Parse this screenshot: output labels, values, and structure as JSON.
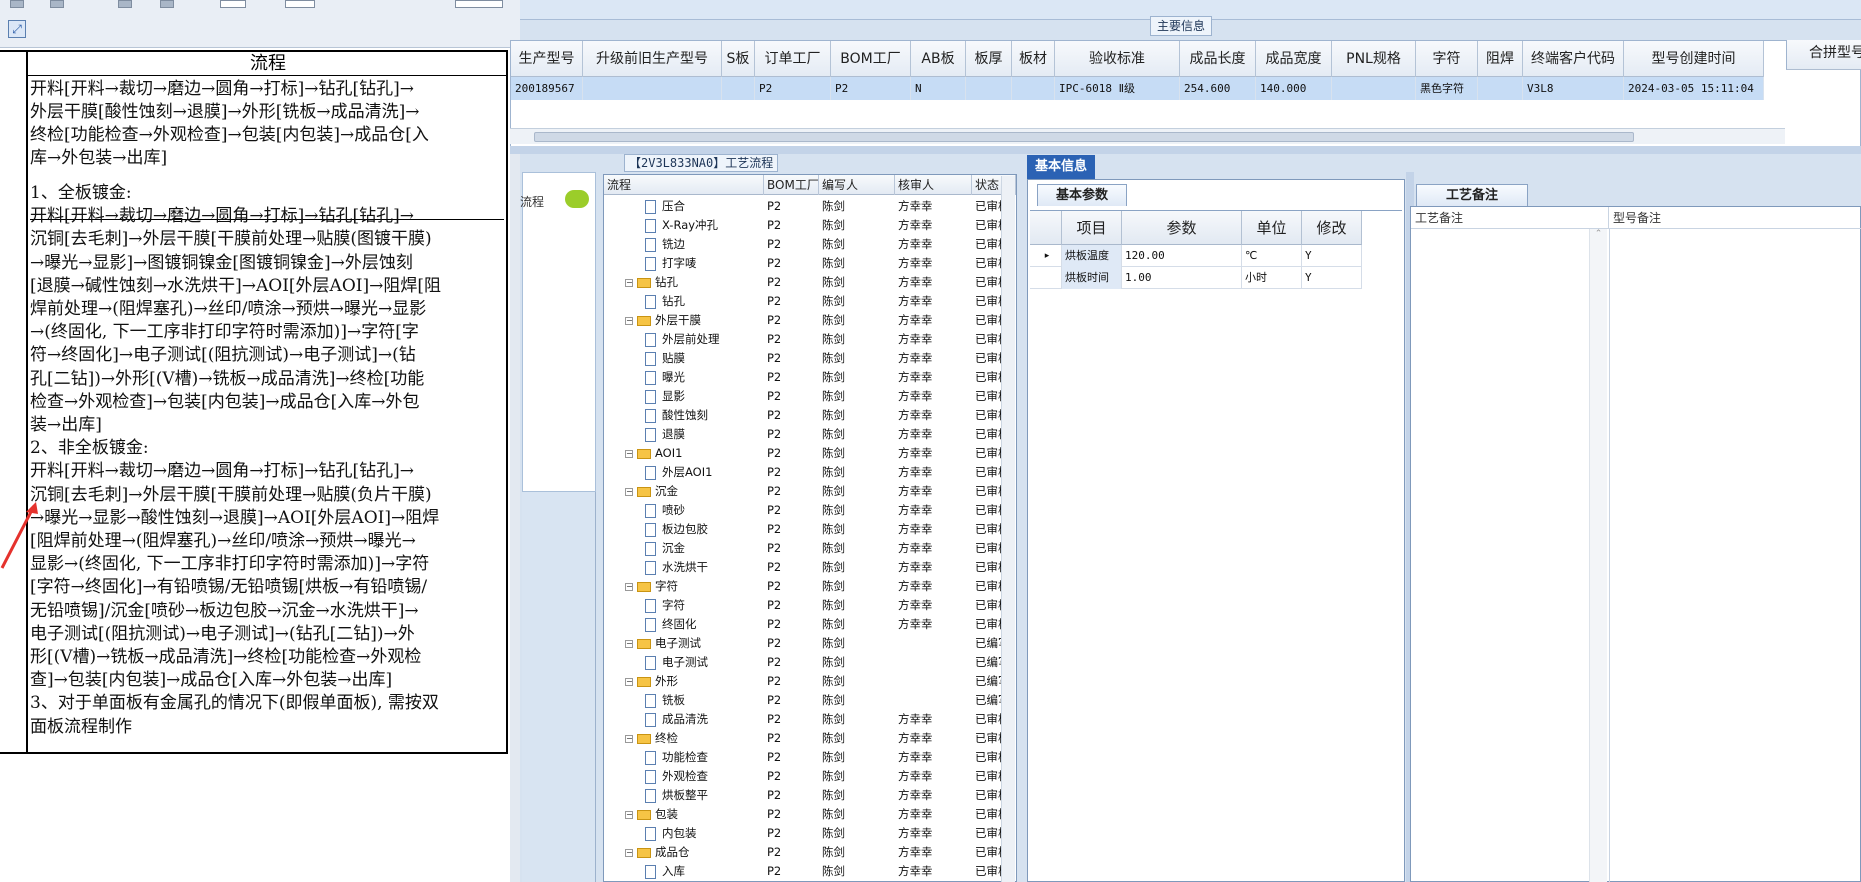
{
  "top_panel": {
    "title": "主要信息",
    "headers": [
      "生产型号",
      "升级前旧生产型号",
      "S板",
      "订单工厂",
      "BOM工厂",
      "AB板",
      "板厚",
      "板材",
      "验收标准",
      "成品长度",
      "成品宽度",
      "PNL规格",
      "字符",
      "阻焊",
      "终端客户代码",
      "型号创建时间"
    ],
    "combine_header": "合拼型号",
    "row": {
      "model": "200189567",
      "order_factory": "P2",
      "bom_factory": "P2",
      "ab_board": "N",
      "acceptance_standard": "IPC-6018 Ⅱ级",
      "length": "254.600",
      "width": "140.000",
      "character": "黑色字符",
      "customer_code": "V3L8",
      "created_time": "2024-03-05 15:11:04"
    }
  },
  "document": {
    "header": "流程",
    "row1": "开料[开料→裁切→磨边→圆角→打标]→钻孔[钻孔]→\n外层干膜[酸性蚀刻→退膜]→外形[铣板→成品清洗]→\n终检[功能检查→外观检查]→包装[内包装]→成品仓[入\n库→外包装→出库]",
    "row2": "1、全板镀金:\n开料[开料→裁切→磨边→圆角→打标]→钻孔[钻孔]→\n沉铜[去毛刺]→外层干膜[干膜前处理→贴膜(图镀干膜)\n→曝光→显影]→图镀铜镍金[图镀铜镍金]→外层蚀刻\n[退膜→碱性蚀刻→水洗烘干]→AOI[外层AOI]→阻焊[阻\n焊前处理→(阻焊塞孔)→丝印/喷涂→预烘→曝光→显影\n→(终固化, 下一工序非打印字符时需添加)]→字符[字\n符→终固化]→电子测试[(阻抗测试)→电子测试]→(钻\n孔[二钻])→外形[(V槽)→铣板→成品清洗]→终检[功能\n检查→外观检查]→包装[内包装]→成品仓[入库→外包\n装→出库]\n2、非全板镀金:\n开料[开料→裁切→磨边→圆角→打标]→钻孔[钻孔]→\n沉铜[去毛刺]→外层干膜[干膜前处理→贴膜(负片干膜)\n→曝光→显影→酸性蚀刻→退膜]→AOI[外层AOI]→阻焊\n[阻焊前处理→(阻焊塞孔)→丝印/喷涂→预烘→曝光→\n显影→(终固化, 下一工序非打印字符时需添加)]→字符\n[字符→终固化]→有铅喷锡/无铅喷锡[烘板→有铅喷锡/\n无铅喷锡]/沉金[喷砂→板边包胶→沉金→水洗烘干]→\n电子测试[(阻抗测试)→电子测试]→(钻孔[二钻])→外\n形[(V槽)→铣板→成品清洗]→终检[功能检查→外观检\n查]→包装[内包装]→成品仓[入库→外包装→出库]\n3、对于单面板有金属孔的情况下(即假单面板), 需按双\n面板流程制作"
  },
  "side_strip": {
    "label": "流程"
  },
  "flow_panel": {
    "title": "【2V3L833NA0】工艺流程",
    "headers": [
      "流程",
      "BOM工厂",
      "编写人",
      "核审人",
      "状态"
    ],
    "rows": [
      {
        "level": 2,
        "kind": "doc",
        "name": "压合",
        "bom": "P2",
        "writer": "陈剑",
        "reviewer": "方幸幸",
        "status": "已审核"
      },
      {
        "level": 2,
        "kind": "doc",
        "name": "X-Ray冲孔",
        "bom": "P2",
        "writer": "陈剑",
        "reviewer": "方幸幸",
        "status": "已审核"
      },
      {
        "level": 2,
        "kind": "doc",
        "name": "铣边",
        "bom": "P2",
        "writer": "陈剑",
        "reviewer": "方幸幸",
        "status": "已审核"
      },
      {
        "level": 2,
        "kind": "doc",
        "name": "打字唛",
        "bom": "P2",
        "writer": "陈剑",
        "reviewer": "方幸幸",
        "status": "已审核"
      },
      {
        "level": 1,
        "kind": "folder",
        "name": "钻孔",
        "bom": "P2",
        "writer": "陈剑",
        "reviewer": "方幸幸",
        "status": "已审核"
      },
      {
        "level": 2,
        "kind": "doc",
        "name": "钻孔",
        "bom": "P2",
        "writer": "陈剑",
        "reviewer": "方幸幸",
        "status": "已审核"
      },
      {
        "level": 1,
        "kind": "folder",
        "name": "外层干膜",
        "bom": "P2",
        "writer": "陈剑",
        "reviewer": "方幸幸",
        "status": "已审核"
      },
      {
        "level": 2,
        "kind": "doc",
        "name": "外层前处理",
        "bom": "P2",
        "writer": "陈剑",
        "reviewer": "方幸幸",
        "status": "已审核"
      },
      {
        "level": 2,
        "kind": "doc",
        "name": "贴膜",
        "bom": "P2",
        "writer": "陈剑",
        "reviewer": "方幸幸",
        "status": "已审核"
      },
      {
        "level": 2,
        "kind": "doc",
        "name": "曝光",
        "bom": "P2",
        "writer": "陈剑",
        "reviewer": "方幸幸",
        "status": "已审核"
      },
      {
        "level": 2,
        "kind": "doc",
        "name": "显影",
        "bom": "P2",
        "writer": "陈剑",
        "reviewer": "方幸幸",
        "status": "已审核"
      },
      {
        "level": 2,
        "kind": "doc",
        "name": "酸性蚀刻",
        "bom": "P2",
        "writer": "陈剑",
        "reviewer": "方幸幸",
        "status": "已审核"
      },
      {
        "level": 2,
        "kind": "doc",
        "name": "退膜",
        "bom": "P2",
        "writer": "陈剑",
        "reviewer": "方幸幸",
        "status": "已审核"
      },
      {
        "level": 1,
        "kind": "folder",
        "name": "AOI1",
        "bom": "P2",
        "writer": "陈剑",
        "reviewer": "方幸幸",
        "status": "已审核"
      },
      {
        "level": 2,
        "kind": "doc",
        "name": "外层AOI1",
        "bom": "P2",
        "writer": "陈剑",
        "reviewer": "方幸幸",
        "status": "已审核"
      },
      {
        "level": 1,
        "kind": "folder",
        "name": "沉金",
        "bom": "P2",
        "writer": "陈剑",
        "reviewer": "方幸幸",
        "status": "已审核"
      },
      {
        "level": 2,
        "kind": "doc",
        "name": "喷砂",
        "bom": "P2",
        "writer": "陈剑",
        "reviewer": "方幸幸",
        "status": "已审核"
      },
      {
        "level": 2,
        "kind": "doc",
        "name": "板边包胶",
        "bom": "P2",
        "writer": "陈剑",
        "reviewer": "方幸幸",
        "status": "已审核"
      },
      {
        "level": 2,
        "kind": "doc",
        "name": "沉金",
        "bom": "P2",
        "writer": "陈剑",
        "reviewer": "方幸幸",
        "status": "已审核"
      },
      {
        "level": 2,
        "kind": "doc",
        "name": "水洗烘干",
        "bom": "P2",
        "writer": "陈剑",
        "reviewer": "方幸幸",
        "status": "已审核"
      },
      {
        "level": 1,
        "kind": "folder",
        "name": "字符",
        "bom": "P2",
        "writer": "陈剑",
        "reviewer": "方幸幸",
        "status": "已审核"
      },
      {
        "level": 2,
        "kind": "doc",
        "name": "字符",
        "bom": "P2",
        "writer": "陈剑",
        "reviewer": "方幸幸",
        "status": "已审核"
      },
      {
        "level": 2,
        "kind": "doc",
        "name": "终固化",
        "bom": "P2",
        "writer": "陈剑",
        "reviewer": "方幸幸",
        "status": "已审核"
      },
      {
        "level": 1,
        "kind": "folder",
        "name": "电子测试",
        "bom": "P2",
        "writer": "陈剑",
        "reviewer": "",
        "status": "已编写"
      },
      {
        "level": 2,
        "kind": "doc",
        "name": "电子测试",
        "bom": "P2",
        "writer": "陈剑",
        "reviewer": "",
        "status": "已编写"
      },
      {
        "level": 1,
        "kind": "folder",
        "name": "外形",
        "bom": "P2",
        "writer": "陈剑",
        "reviewer": "",
        "status": "已编写"
      },
      {
        "level": 2,
        "kind": "doc",
        "name": "铣板",
        "bom": "P2",
        "writer": "陈剑",
        "reviewer": "",
        "status": "已编写"
      },
      {
        "level": 2,
        "kind": "doc",
        "name": "成品清洗",
        "bom": "P2",
        "writer": "陈剑",
        "reviewer": "方幸幸",
        "status": "已审核"
      },
      {
        "level": 1,
        "kind": "folder",
        "name": "终检",
        "bom": "P2",
        "writer": "陈剑",
        "reviewer": "方幸幸",
        "status": "已审核"
      },
      {
        "level": 2,
        "kind": "doc",
        "name": "功能检查",
        "bom": "P2",
        "writer": "陈剑",
        "reviewer": "方幸幸",
        "status": "已审核"
      },
      {
        "level": 2,
        "kind": "doc",
        "name": "外观检查",
        "bom": "P2",
        "writer": "陈剑",
        "reviewer": "方幸幸",
        "status": "已审核"
      },
      {
        "level": 2,
        "kind": "doc",
        "name": "烘板整平",
        "bom": "P2",
        "writer": "陈剑",
        "reviewer": "方幸幸",
        "status": "已审核"
      },
      {
        "level": 1,
        "kind": "folder",
        "name": "包装",
        "bom": "P2",
        "writer": "陈剑",
        "reviewer": "方幸幸",
        "status": "已审核"
      },
      {
        "level": 2,
        "kind": "doc",
        "name": "内包装",
        "bom": "P2",
        "writer": "陈剑",
        "reviewer": "方幸幸",
        "status": "已审核"
      },
      {
        "level": 1,
        "kind": "folder",
        "name": "成品仓",
        "bom": "P2",
        "writer": "陈剑",
        "reviewer": "方幸幸",
        "status": "已审核"
      },
      {
        "level": 2,
        "kind": "doc",
        "name": "入库",
        "bom": "P2",
        "writer": "陈剑",
        "reviewer": "方幸幸",
        "status": "已审核"
      }
    ]
  },
  "basic_panel": {
    "tab": "基本信息",
    "subtab": "基本参数",
    "headers": [
      "项目",
      "参数",
      "单位",
      "修改"
    ],
    "rows": [
      {
        "item": "烘板温度",
        "param": "120.00",
        "unit": "℃",
        "edit": "Y"
      },
      {
        "item": "烘板时间",
        "param": "1.00",
        "unit": "小时",
        "edit": "Y"
      }
    ]
  },
  "remark_panel": {
    "tab": "工艺备注",
    "col1": "工艺备注",
    "col2": "型号备注"
  },
  "colors": {
    "selected_row": "#c6dcf5",
    "accent": "#2b62b4",
    "annotation_arrow": "#e5322d"
  }
}
